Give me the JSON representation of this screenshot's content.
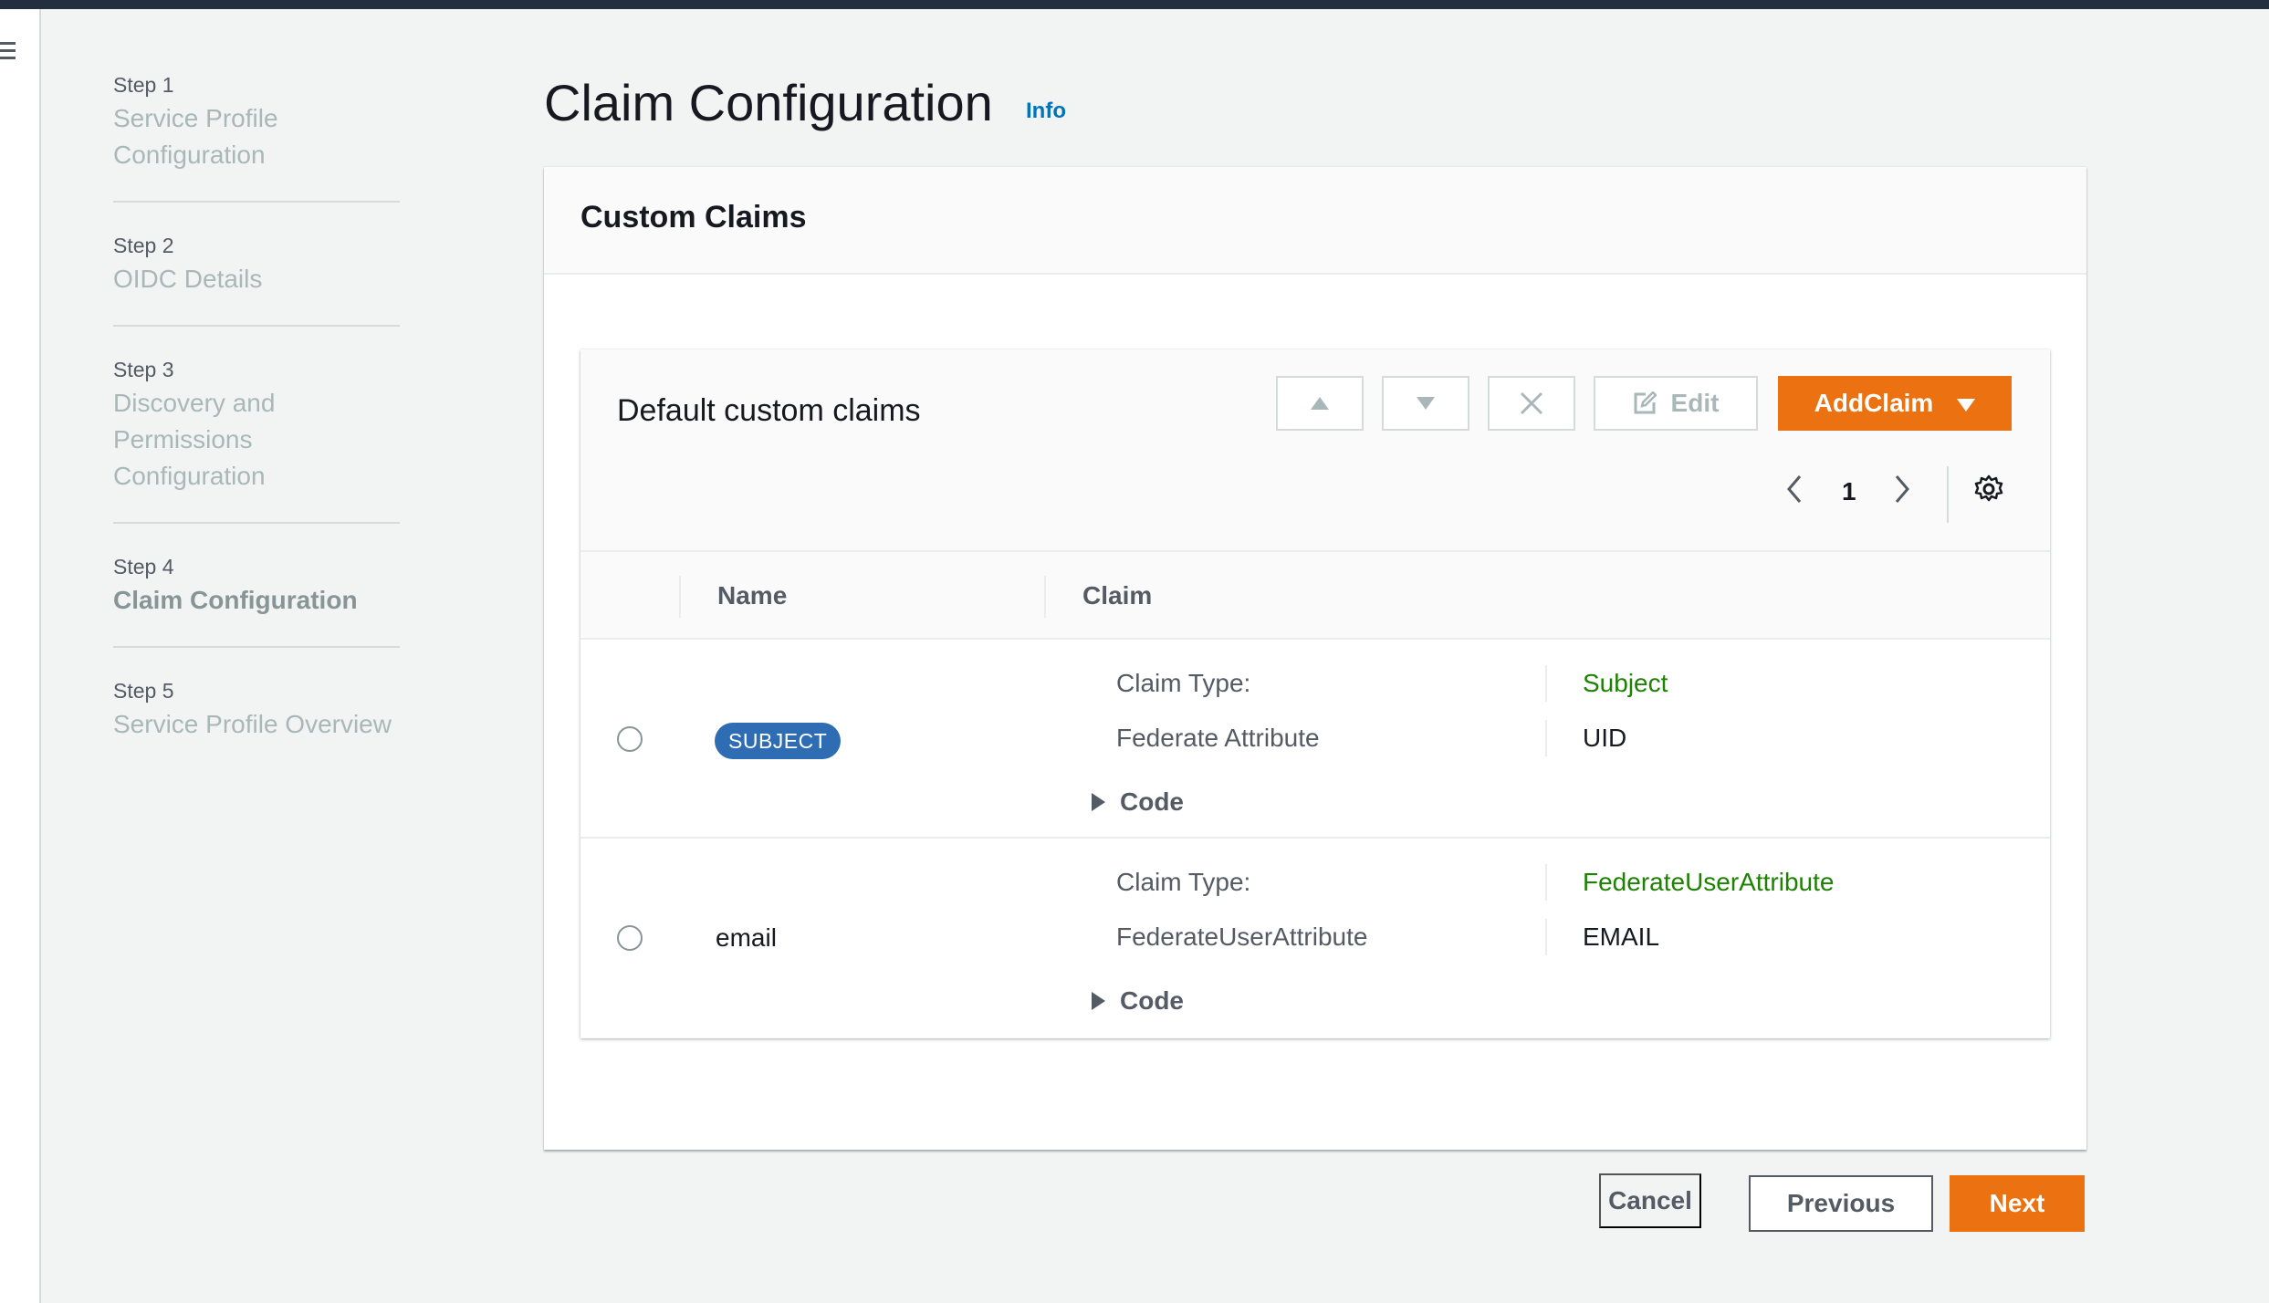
{
  "nav": {
    "steps": [
      {
        "number": "Step 1",
        "title": "Service Profile Configuration"
      },
      {
        "number": "Step 2",
        "title": "OIDC Details"
      },
      {
        "number": "Step 3",
        "title": "Discovery and Permissions Configuration"
      },
      {
        "number": "Step 4",
        "title": "Claim Configuration"
      },
      {
        "number": "Step 5",
        "title": "Service Profile Overview"
      }
    ],
    "active_step": 4
  },
  "page": {
    "title": "Claim Configuration",
    "info_link": "Info"
  },
  "container": {
    "title": "Custom Claims"
  },
  "table": {
    "title": "Default custom claims",
    "toolbar": {
      "move_up_icon": "triangle-up-icon",
      "move_down_icon": "triangle-down-icon",
      "delete_icon": "close-icon",
      "edit_label": "Edit",
      "add_label": "AddClaim"
    },
    "pagination": {
      "current_page": "1"
    },
    "columns": [
      "Name",
      "Claim"
    ],
    "rows": [
      {
        "name": "SUBJECT",
        "name_style": "badge",
        "claim_type_label": "Claim Type:",
        "claim_type_value": "Subject",
        "attribute_label": "Federate Attribute",
        "attribute_value": "UID",
        "code_label": "Code"
      },
      {
        "name": "email",
        "name_style": "text",
        "claim_type_label": "Claim Type:",
        "claim_type_value": "FederateUserAttribute",
        "attribute_label": "FederateUserAttribute",
        "attribute_value": "EMAIL",
        "code_label": "Code"
      }
    ]
  },
  "footer": {
    "cancel_label": "Cancel",
    "previous_label": "Previous",
    "next_label": "Next"
  },
  "colors": {
    "primary_orange": "#ec7211",
    "link_blue": "#0073bb",
    "badge_blue": "#2e6cb3",
    "value_green": "#1d8102",
    "topbar": "#232f3e"
  }
}
